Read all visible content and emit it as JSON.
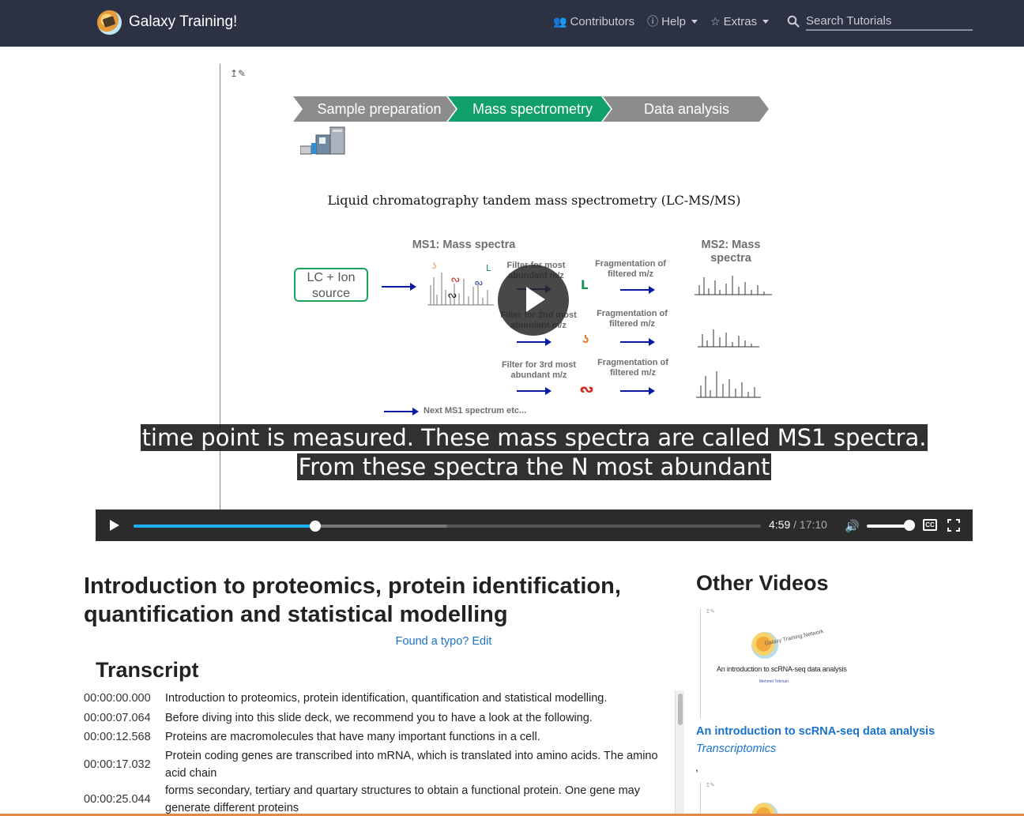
{
  "navbar": {
    "brand": "Galaxy Training!",
    "items": [
      {
        "label": "Contributors",
        "icon": "users-icon",
        "dropdown": false
      },
      {
        "label": "Help",
        "icon": "question-circle-icon",
        "dropdown": true
      },
      {
        "label": "Extras",
        "icon": "star-icon",
        "dropdown": true
      }
    ],
    "search_placeholder": "Search Tutorials"
  },
  "slide": {
    "workflow_steps": [
      "Sample preparation",
      "Mass spectrometry",
      "Data analysis"
    ],
    "active_step": "Mass spectrometry",
    "title": "Liquid chromatography tandem mass spectrometry (LC-MS/MS)",
    "ms1_label": "MS1: Mass spectra",
    "ms2_label": "MS2: Mass spectra",
    "lc_label": "LC + Ion source",
    "filters": [
      "Filter for most abundant m/z",
      "Filter for 2nd most abundant m/z",
      "Filter for 3rd most abundant m/z"
    ],
    "fragmentation": "Fragmentation of filtered m/z",
    "next_label": "Next MS1 spectrum etc..."
  },
  "player": {
    "captions": [
      "time point is measured. These mass spectra are called MS1 spectra.",
      "From these spectra the N most abundant"
    ],
    "current_time": "4:59",
    "duration": "17:10",
    "progress_fraction": 0.29,
    "buffered_fraction": 0.5,
    "volume_fraction": 1.0
  },
  "main": {
    "title": "Introduction to proteomics, protein identification, quantification and statistical modelling",
    "typo_link": "Found a typo? Edit",
    "transcript_heading": "Transcript",
    "transcript": [
      {
        "time": "00:00:00.000",
        "text": "Introduction to proteomics, protein identification, quantification and statistical modelling."
      },
      {
        "time": "00:00:07.064",
        "text": "Before diving into this slide deck, we recommend you to have a look at the following."
      },
      {
        "time": "00:00:12.568",
        "text": "Proteins are macromolecules that have many important functions in a cell."
      },
      {
        "time": "00:00:17.032",
        "text": "Protein coding genes are transcribed into mRNA, which is translated into amino acids. The amino acid chain"
      },
      {
        "time": "00:00:25.044",
        "text": "forms secondary, tertiary and quartary structures to obtain a functional protein. One gene may generate different proteins"
      }
    ]
  },
  "sidebar": {
    "heading": "Other Videos",
    "videos": [
      {
        "title": "An introduction to scRNA-seq data analysis",
        "category": "Transcriptomics",
        "thumb_caption": "An introduction to scRNA-seq data analysis",
        "thumb_author": "Mehmet Tekman",
        "thumb_brand": "Galaxy Training Network"
      }
    ],
    "separator": ","
  },
  "colors": {
    "navbar_bg": "#2c3143",
    "active_step": "#12a06a",
    "inactive_step": "#8c8c8c",
    "progress": "#1eb0f0",
    "link": "#1a73c9"
  }
}
